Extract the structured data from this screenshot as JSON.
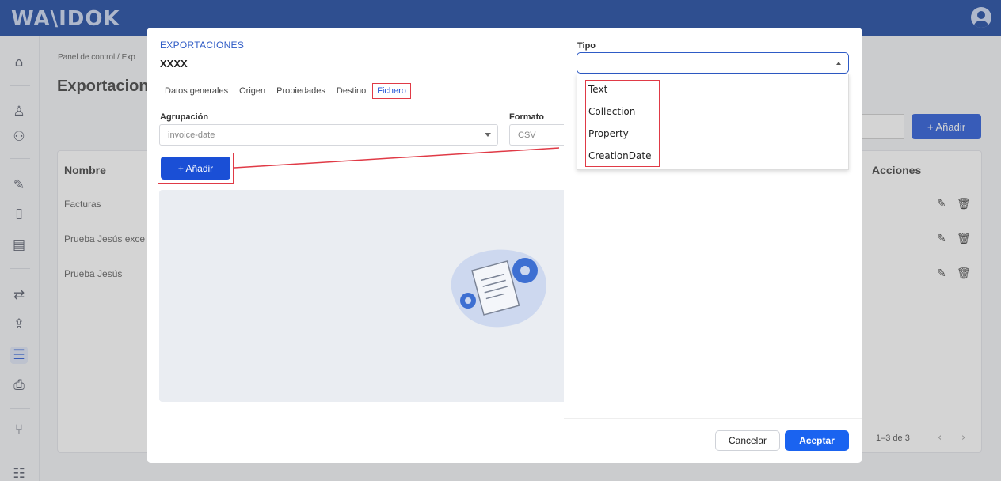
{
  "app": {
    "logo": "WA\\IDOK"
  },
  "breadcrumb": {
    "text": "Panel de control  /  Exp"
  },
  "page": {
    "title": "Exportacion"
  },
  "toolbar": {
    "add_label": "+  Añadir"
  },
  "table": {
    "headers": {
      "name": "Nombre",
      "actions": "Acciones"
    },
    "rows": [
      {
        "name": "Facturas"
      },
      {
        "name": "Prueba Jesús exce"
      },
      {
        "name": "Prueba Jesús"
      }
    ],
    "pagination": {
      "range": "1–3 de 3"
    }
  },
  "modal": {
    "kicker": "EXPORTACIONES",
    "name": "XXXX",
    "tabs": [
      "Datos generales",
      "Origen",
      "Propiedades",
      "Destino",
      "Fichero"
    ],
    "active_tab": "Fichero",
    "agrupacion": {
      "label": "Agrupación",
      "value": "invoice-date"
    },
    "formato": {
      "label": "Formato",
      "value": "CSV"
    },
    "add_label": "+  Añadir"
  },
  "drawer": {
    "tipo_label": "Tipo",
    "tipo_value": "",
    "options": [
      "Text",
      "Collection",
      "Property",
      "CreationDate"
    ],
    "cancel_label": "Cancelar",
    "accept_label": "Aceptar"
  },
  "colors": {
    "primary": "#1a4fd6",
    "topbar": "#0d3b9b",
    "highlight": "#e03a46"
  },
  "icons": {
    "sidebar": [
      "home-icon",
      "user-icon",
      "users-icon",
      "document-sign-icon",
      "tablet-icon",
      "archive-icon",
      "transfer-icon",
      "upload-icon",
      "export-list-icon",
      "import-icon",
      "fork-icon",
      "form-icon"
    ],
    "row_actions": [
      "edit-icon",
      "delete-icon"
    ]
  }
}
